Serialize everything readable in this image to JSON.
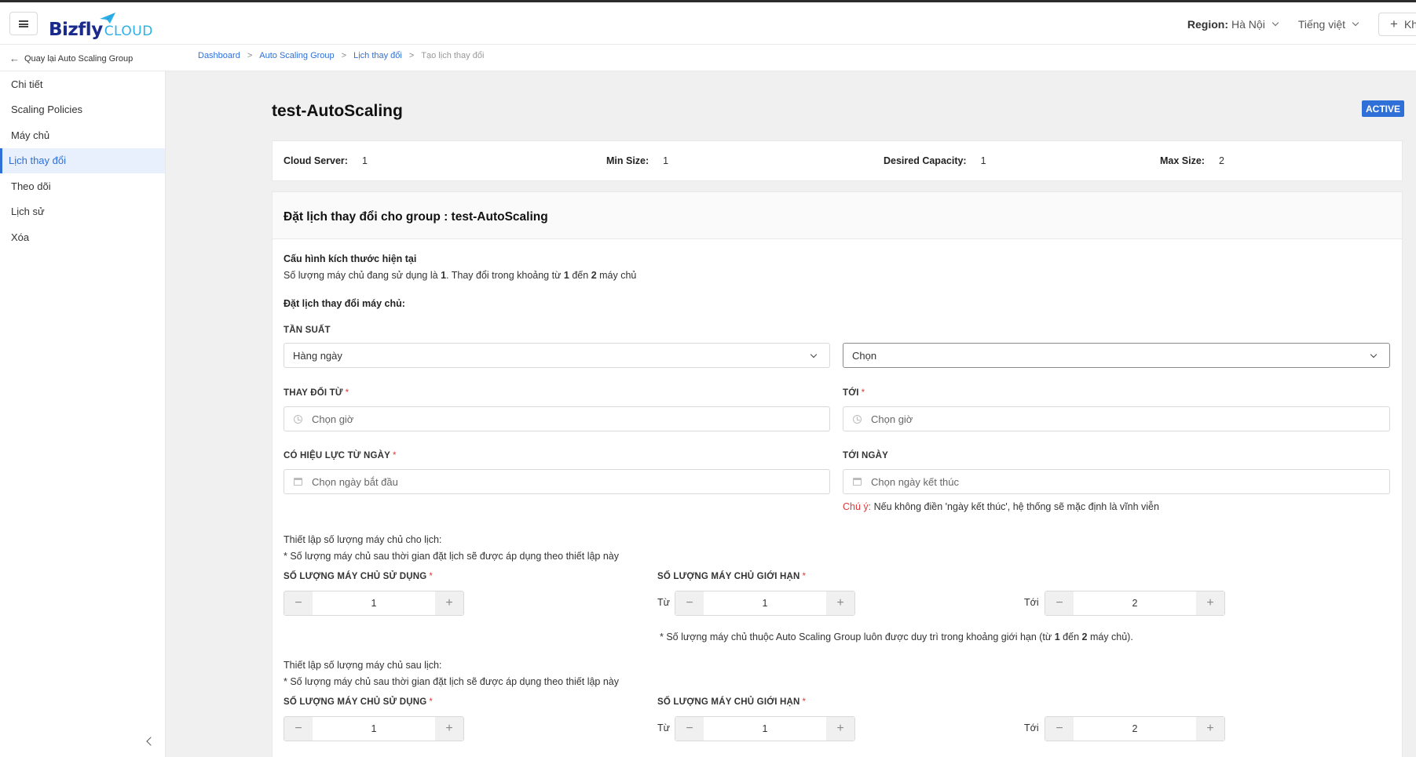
{
  "header": {
    "logo_main": "Bizfly",
    "logo_cloud": "CLOUD",
    "region_label": "Region:",
    "region_value": "Hà Nội",
    "language": "Tiếng việt",
    "create_label": "Khởi tạo"
  },
  "subbar": {
    "back_label": "Quay lại Auto Scaling Group",
    "breadcrumb": [
      "Dashboard",
      "Auto Scaling Group",
      "Lịch thay đổi",
      "Tạo lịch thay đổi"
    ]
  },
  "sidebar": {
    "items": [
      {
        "label": "Chi tiết"
      },
      {
        "label": "Scaling Policies"
      },
      {
        "label": "Máy chủ"
      },
      {
        "label": "Lịch thay đổi"
      },
      {
        "label": "Theo dõi"
      },
      {
        "label": "Lịch sử"
      },
      {
        "label": "Xóa"
      }
    ]
  },
  "page": {
    "title": "test-AutoScaling",
    "status": "ACTIVE"
  },
  "info": {
    "cloud_server_label": "Cloud Server:",
    "cloud_server_value": "1",
    "min_size_label": "Min Size:",
    "min_size_value": "1",
    "desired_label": "Desired Capacity:",
    "desired_value": "1",
    "max_size_label": "Max Size:",
    "max_size_value": "2"
  },
  "form": {
    "heading": "Đặt lịch thay đổi cho group : test-AutoScaling",
    "current_config_title": "Cấu hình kích thước hiện tại",
    "current_config_text_1": "Số lượng máy chủ đang sử dụng là ",
    "current_config_val_1": "1",
    "current_config_text_2": ". Thay đổi trong khoảng từ ",
    "current_config_val_2": "1",
    "current_config_text_3": " đến ",
    "current_config_val_3": "2",
    "current_config_text_4": " máy chủ",
    "schedule_title": "Đặt lịch thay đổi máy chủ:",
    "frequency_label": "TẦN SUẤT",
    "frequency_value": "Hàng ngày",
    "frequency_sub_value": "Chọn",
    "change_from_label": "THAY ĐỔI TỪ",
    "change_from_placeholder": "Chọn giờ",
    "to_label": "TỚI",
    "to_placeholder": "Chọn giờ",
    "effective_from_label": "CÓ HIỆU LỰC TỪ NGÀY",
    "effective_from_placeholder": "Chọn ngày bắt đầu",
    "effective_to_label": "TỚI NGÀY",
    "effective_to_placeholder": "Chọn ngày kết thúc",
    "note_warn": "Chú ý:",
    "note_text": " Nếu không điền 'ngày kết thúc', hệ thống sẽ mặc định là vĩnh viễn",
    "req_mark": "*"
  },
  "during": {
    "title": "Thiết lập số lượng máy chủ cho lịch:",
    "subtitle": "* Số lượng máy chủ sau thời gian đặt lịch sẽ được áp dụng theo thiết lập này",
    "used_label": "SỐ LƯỢNG MÁY CHỦ SỬ DỤNG",
    "used_value": "1",
    "limit_label": "SỐ LƯỢNG MÁY CHỦ GIỚI HẠN",
    "from_label": "Từ",
    "from_value": "1",
    "to_label": "Tới",
    "to_value": "2",
    "limit_note_1": "* Số lượng máy chủ thuộc Auto Scaling Group luôn được duy trì trong khoảng giới hạn (từ ",
    "limit_note_v1": "1",
    "limit_note_2": " đến ",
    "limit_note_v2": "2",
    "limit_note_3": " máy chủ)."
  },
  "after": {
    "title": "Thiết lập số lượng máy chủ sau lịch:",
    "subtitle": "* Số lượng máy chủ sau thời gian đặt lịch sẽ được áp dụng theo thiết lập này",
    "used_label": "SỐ LƯỢNG MÁY CHỦ SỬ DỤNG",
    "used_value": "1",
    "limit_label": "SỐ LƯỢNG MÁY CHỦ GIỚI HẠN",
    "from_label": "Từ",
    "from_value": "1",
    "to_label": "Tới",
    "to_value": "2"
  },
  "stepper": {
    "minus": "−",
    "plus": "+"
  }
}
